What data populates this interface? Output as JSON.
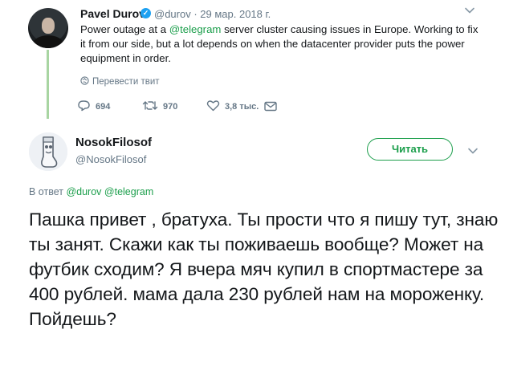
{
  "parent_tweet": {
    "author_name": "Pavel Durov",
    "verified_icon": "verified-badge-icon",
    "handle": "@durov",
    "separator": " · ",
    "date": "29 мар. 2018 г.",
    "text_before": "Power outage at a ",
    "mention": "@telegram",
    "text_after": " server cluster causing issues in Europe. Working to fix it from our side, but a lot depends on when the datacenter provider puts the power equipment in order.",
    "translate_label": "Перевести твит",
    "replies": "694",
    "retweets": "970",
    "likes": "3,8 тыс."
  },
  "reply_tweet": {
    "author_name": "NosokFilosof",
    "handle": "@NosokFilosof",
    "follow_label": "Читать",
    "reply_prefix": "В ответ ",
    "reply_mention_1": "@durov",
    "reply_mention_2": "@telegram",
    "text": "Пашка привет , братуха. Ты прости что я пишу тут, знаю ты занят.  Скажи как ты поживаешь вообще? Может на футбик сходим? Я вчера мяч купил в спортмастере за 400 рублей. мама дала 230 рублей нам на мороженку. Пойдешь?"
  },
  "colors": {
    "accent": "#1b9e4b",
    "thread_line": "#a8d5a2",
    "muted": "#657786",
    "text": "#14171a"
  }
}
